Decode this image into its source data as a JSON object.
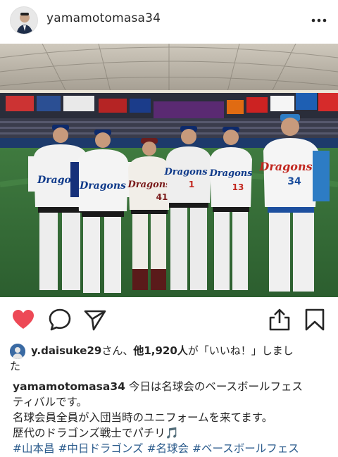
{
  "post": {
    "username": "yamamotomasa34",
    "icons": {
      "more": "more-dots-icon",
      "like": "heart-filled-icon",
      "comment": "comment-bubble-icon",
      "share": "send-paper-plane-icon",
      "upload": "share-upload-icon",
      "save": "bookmark-icon"
    },
    "colors": {
      "like": "#ed4956",
      "hashtag": "#2b5b8c",
      "text": "#262626"
    }
  },
  "photo": {
    "jerseys": [
      {
        "team": "Dragons",
        "number": ""
      },
      {
        "team": "Dragons",
        "number": ""
      },
      {
        "team": "Dragons",
        "number": "41"
      },
      {
        "team": "Dragons",
        "number": "1"
      },
      {
        "team": "Dragons",
        "number": "13"
      },
      {
        "team": "Dragons",
        "number": "34"
      }
    ]
  },
  "likes": {
    "user": "y.daisuke29",
    "mid": "さん、",
    "others": "他1,920人",
    "suffix": "が「いいね！」しまし",
    "cont": "た"
  },
  "caption": {
    "username": "yamamotomasa34",
    "line1": " 今日は名球会のベースボールフェス",
    "line2": "ティバルです。",
    "line3": "名球会員全員が入団当時のユニフォームを来てます。",
    "line4": "歴代のドラゴンズ戦士でパチリ🎵",
    "hashtags": [
      "#山本昌",
      "#中日ドラゴンズ",
      "#名球会",
      "#ベースボールフェス"
    ]
  }
}
